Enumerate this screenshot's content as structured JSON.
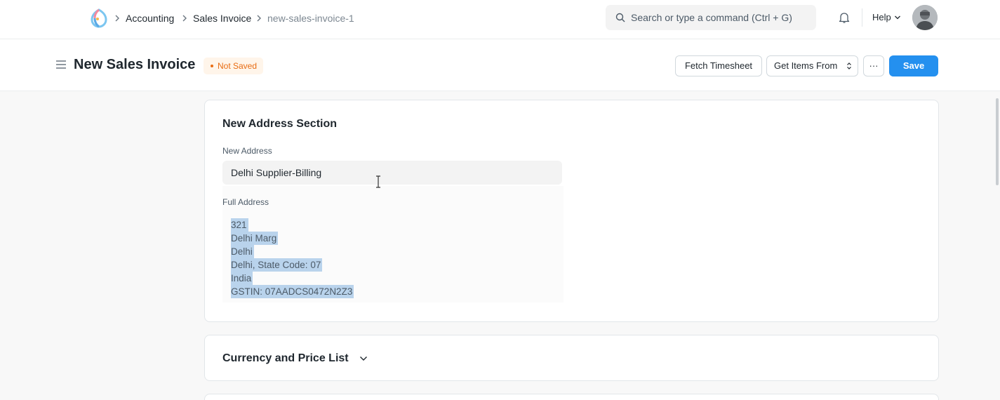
{
  "navbar": {
    "breadcrumbs": [
      "Accounting",
      "Sales Invoice",
      "new-sales-invoice-1"
    ],
    "search_placeholder": "Search or type a command (Ctrl + G)",
    "help_label": "Help"
  },
  "header": {
    "title": "New Sales Invoice",
    "status": "Not Saved",
    "buttons": {
      "fetch_timesheet": "Fetch Timesheet",
      "get_items_from": "Get Items From",
      "more": "···",
      "save": "Save"
    }
  },
  "address_section": {
    "title": "New Address Section",
    "new_address_label": "New Address",
    "new_address_value": "Delhi Supplier-Billing",
    "full_address_label": "Full Address",
    "full_address_lines": [
      "321",
      "Delhi Marg",
      "Delhi",
      "Delhi, State Code: 07",
      "India",
      "GSTIN: 07AADCS0472N2Z3"
    ]
  },
  "currency_section": {
    "title": "Currency and Price List"
  },
  "colors": {
    "primary": "#2490ef",
    "status_orange": "#e86c13",
    "selection": "#b9d3ec"
  },
  "icons": [
    "app-logo-icon",
    "chevron-right-icon",
    "search-icon",
    "bell-icon",
    "chevron-down-icon",
    "hamburger-icon",
    "up-down-icon",
    "text-cursor-icon"
  ]
}
